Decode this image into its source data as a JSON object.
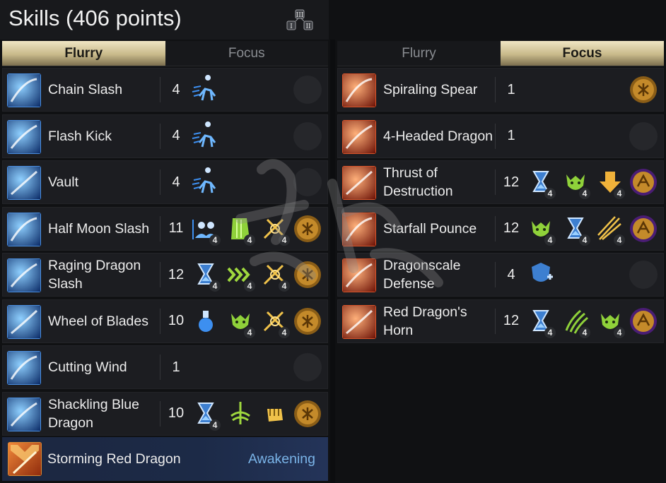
{
  "title": "Skills (406 points)",
  "left_panel": {
    "tabs": [
      {
        "label": "Flurry",
        "active": true
      },
      {
        "label": "Focus",
        "active": false
      }
    ],
    "skills": [
      {
        "name": "Chain Slash",
        "level": "4",
        "tripods": [
          {
            "icon": "running-figure-icon",
            "badge": ""
          }
        ],
        "rune": "empty"
      },
      {
        "name": "Flash Kick",
        "level": "4",
        "tripods": [
          {
            "icon": "running-figure-icon",
            "badge": ""
          }
        ],
        "rune": "empty"
      },
      {
        "name": "Vault",
        "level": "4",
        "tripods": [
          {
            "icon": "running-figure-icon",
            "badge": ""
          }
        ],
        "rune": "empty"
      },
      {
        "name": "Half Moon Slash",
        "level": "11",
        "tripods": [
          {
            "icon": "shield-ally-icon",
            "badge": "4"
          },
          {
            "icon": "green-bar-icon",
            "badge": "4"
          },
          {
            "icon": "crossed-swords-icon",
            "badge": "4"
          }
        ],
        "rune": "gold"
      },
      {
        "name": "Raging Dragon Slash",
        "level": "12",
        "tripods": [
          {
            "icon": "hourglass-icon",
            "badge": "4"
          },
          {
            "icon": "chevron-arrows-icon",
            "badge": "4"
          },
          {
            "icon": "crossed-swords-icon",
            "badge": "4"
          }
        ],
        "rune": "gold"
      },
      {
        "name": "Wheel of Blades",
        "level": "10",
        "tripods": [
          {
            "icon": "potion-icon",
            "badge": ""
          },
          {
            "icon": "beast-head-icon",
            "badge": "4"
          },
          {
            "icon": "crossed-swords-icon",
            "badge": "4"
          }
        ],
        "rune": "gold"
      },
      {
        "name": "Cutting Wind",
        "level": "1",
        "tripods": [],
        "rune": "empty"
      },
      {
        "name": "Shackling Blue Dragon",
        "level": "10",
        "tripods": [
          {
            "icon": "hourglass-icon",
            "badge": "4"
          },
          {
            "icon": "whirl-icon",
            "badge": ""
          },
          {
            "icon": "fist-icon",
            "badge": ""
          }
        ],
        "rune": "gold"
      }
    ],
    "awakening": {
      "name": "Storming Red Dragon",
      "label": "Awakening"
    }
  },
  "right_panel": {
    "tabs": [
      {
        "label": "Flurry",
        "active": false
      },
      {
        "label": "Focus",
        "active": true
      }
    ],
    "skills": [
      {
        "name": "Spiraling Spear",
        "level": "1",
        "tripods": [],
        "rune": "gold"
      },
      {
        "name": "4-Headed Dragon",
        "level": "1",
        "tripods": [],
        "rune": "empty"
      },
      {
        "name": "Thrust of Destruction",
        "level": "12",
        "tripods": [
          {
            "icon": "hourglass-icon",
            "badge": "4"
          },
          {
            "icon": "beast-head-icon",
            "badge": "4"
          },
          {
            "icon": "down-arrow-icon",
            "badge": "4"
          }
        ],
        "rune": "purple"
      },
      {
        "name": "Starfall Pounce",
        "level": "12",
        "tripods": [
          {
            "icon": "beast-head-icon",
            "badge": "4"
          },
          {
            "icon": "hourglass-icon",
            "badge": "4"
          },
          {
            "icon": "spear-burst-icon",
            "badge": "4"
          }
        ],
        "rune": "purple"
      },
      {
        "name": "Dragonscale Defense",
        "level": "4",
        "tripods": [
          {
            "icon": "shield-plus-icon",
            "badge": ""
          }
        ],
        "rune": "empty"
      },
      {
        "name": "Red Dragon's Horn",
        "level": "12",
        "tripods": [
          {
            "icon": "hourglass-icon",
            "badge": "4"
          },
          {
            "icon": "claw-icon",
            "badge": "4"
          },
          {
            "icon": "beast-head-icon",
            "badge": "4"
          }
        ],
        "rune": "purple"
      }
    ]
  },
  "colors": {
    "blue_skill": "#2a6fd0",
    "red_skill": "#c83a1c",
    "gold_rune": "#b88a2a",
    "purple_rune": "#5b2a8c",
    "awakening_text": "#7ab4e8"
  }
}
